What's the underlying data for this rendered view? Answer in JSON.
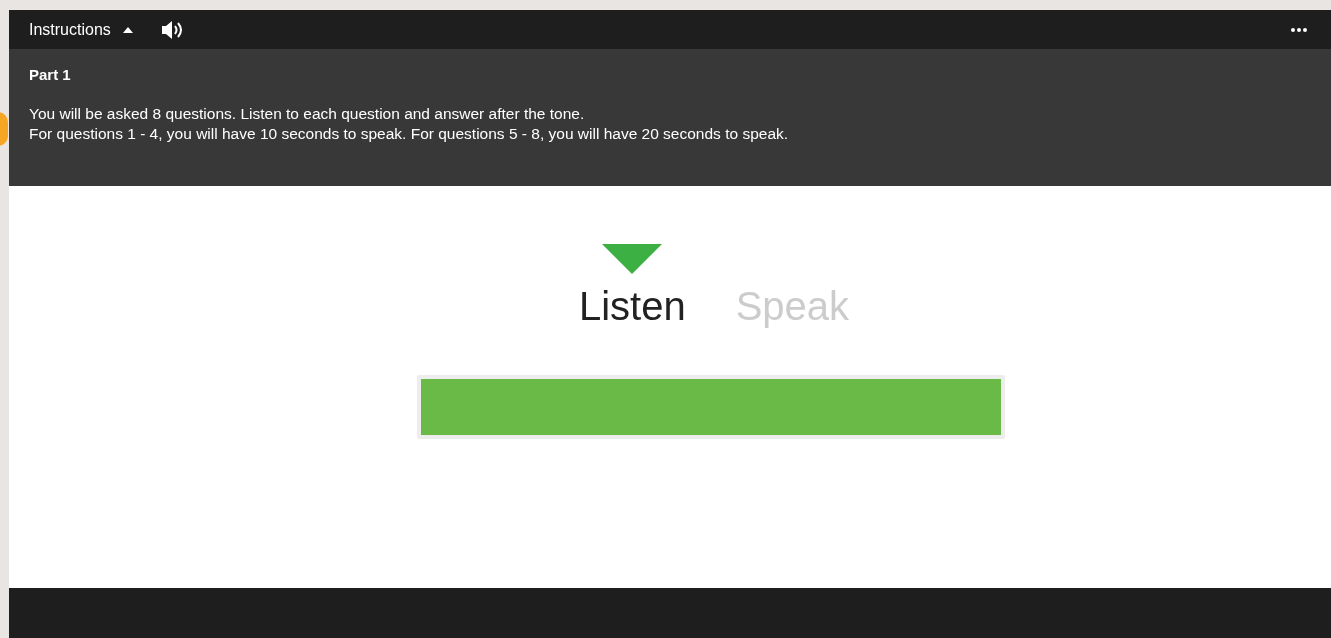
{
  "toolbar": {
    "instructions_label": "Instructions",
    "expanded": true
  },
  "instructions": {
    "title": "Part 1",
    "lines": [
      "You will be asked 8 questions. Listen to each question and answer after the tone.",
      "For questions 1 - 4, you will have 10 seconds to speak. For questions 5 - 8, you will have 20 seconds to speak."
    ]
  },
  "stages": [
    {
      "label": "Listen",
      "selected": true
    },
    {
      "label": "Speak",
      "selected": false
    }
  ],
  "progress": {
    "level": 1
  }
}
